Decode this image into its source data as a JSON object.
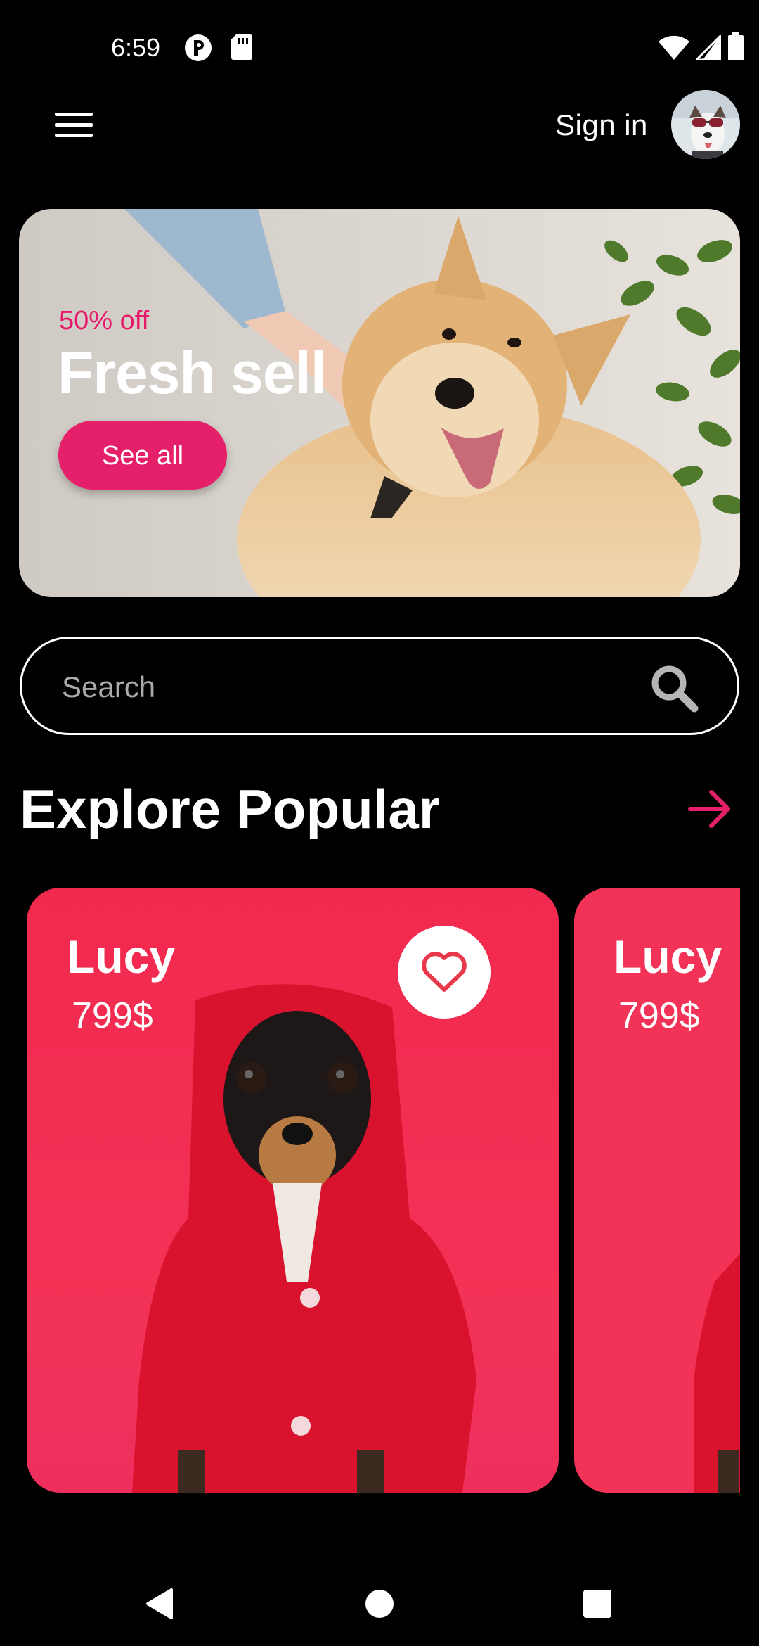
{
  "status_bar": {
    "time": "6:59",
    "left_icons": [
      "notification-p-icon",
      "sd-card-icon"
    ],
    "right_icons": [
      "wifi-icon",
      "cellular-signal-icon",
      "battery-icon"
    ]
  },
  "app_bar": {
    "menu_icon": "hamburger-menu-icon",
    "sign_in_label": "Sign in",
    "avatar_alt": "user-avatar"
  },
  "banner": {
    "discount": "50% off",
    "title": "Fresh sell",
    "button_label": "See all"
  },
  "search": {
    "placeholder": "Search",
    "icon": "search-icon"
  },
  "section": {
    "title": "Explore Popular",
    "arrow_icon": "arrow-right-icon"
  },
  "products": [
    {
      "name": "Lucy",
      "price": "799$",
      "favorite_icon": "heart-outline-icon"
    },
    {
      "name": "Lucy",
      "price": "799$"
    }
  ],
  "nav_bar": {
    "icons": [
      "back-icon",
      "home-icon",
      "recents-icon"
    ]
  },
  "colors": {
    "background": "#000000",
    "accent": "#e61f6b",
    "card": "#f0294f",
    "heart": "#e8394a"
  }
}
